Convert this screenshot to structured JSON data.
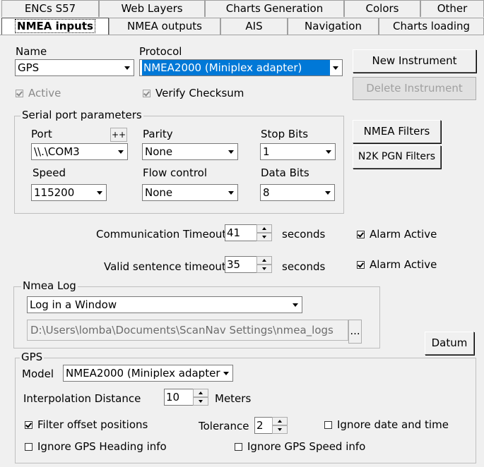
{
  "tabs_row1": [
    "ENCs S57",
    "Web Layers",
    "Charts Generation",
    "Colors",
    "Other"
  ],
  "tabs_row2": [
    "NMEA inputs",
    "NMEA outputs",
    "AIS",
    "Navigation",
    "Charts loading"
  ],
  "instrument": {
    "name_label": "Name",
    "name_value": "GPS",
    "protocol_label": "Protocol",
    "protocol_value": "NMEA2000 (Miniplex adapter)",
    "active_label": "Active",
    "verify_label": "Verify Checksum"
  },
  "buttons": {
    "new_instrument": "New Instrument",
    "delete_instrument": "Delete Instrument",
    "nmea_filters": "NMEA Filters",
    "n2k_filters": "N2K PGN Filters",
    "datum": "Datum",
    "port_plus": "++",
    "browse": "..."
  },
  "serial": {
    "title": "Serial port parameters",
    "port_label": "Port",
    "port_value": "\\\\.\\COM3",
    "parity_label": "Parity",
    "parity_value": "None",
    "stopbits_label": "Stop Bits",
    "stopbits_value": "1",
    "speed_label": "Speed",
    "speed_value": "115200",
    "flow_label": "Flow control",
    "flow_value": "None",
    "databits_label": "Data Bits",
    "databits_value": "8"
  },
  "timeouts": {
    "comm_label": "Communication Timeout",
    "comm_value": "41",
    "valid_label": "Valid sentence timeout",
    "valid_value": "35",
    "unit": "seconds",
    "alarm_label": "Alarm Active"
  },
  "log": {
    "title": "Nmea Log",
    "mode": "Log in a Window",
    "path": "D:\\Users\\lomba\\Documents\\ScanNav Settings\\nmea_logs"
  },
  "gps": {
    "title": "GPS",
    "model_label": "Model",
    "model_value": "NMEA2000 (Miniplex adapter",
    "interp_label": "Interpolation Distance",
    "interp_value": "10",
    "interp_unit": "Meters",
    "filter_label": "Filter offset positions",
    "tolerance_label": "Tolerance",
    "tolerance_value": "2",
    "ignore_date_label": "Ignore date and time",
    "ignore_heading_label": "Ignore GPS Heading info",
    "ignore_speed_label": "Ignore GPS Speed info"
  }
}
